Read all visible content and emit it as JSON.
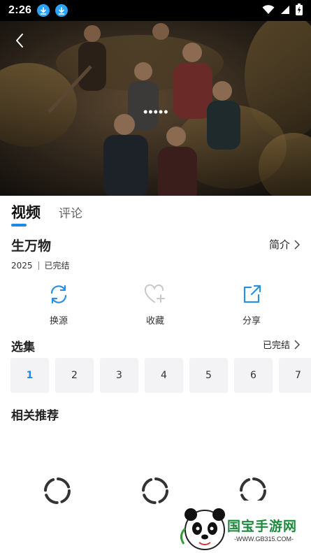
{
  "status_bar": {
    "time": "2:26"
  },
  "player": {
    "loading_indicator": "•••••"
  },
  "tabs": [
    {
      "label": "视频",
      "active": true
    },
    {
      "label": "评论",
      "active": false
    }
  ],
  "show": {
    "title": "生万物",
    "year": "2025",
    "status": "已完结"
  },
  "intro_link": "简介",
  "actions": [
    {
      "label": "换源",
      "icon": "refresh-icon"
    },
    {
      "label": "收藏",
      "icon": "heart-plus-icon"
    },
    {
      "label": "分享",
      "icon": "share-icon"
    }
  ],
  "episodes": {
    "header": "选集",
    "status": "已完结",
    "items": [
      "1",
      "2",
      "3",
      "4",
      "5",
      "6",
      "7"
    ],
    "selected": "1"
  },
  "recommendations": {
    "header": "相关推荐"
  },
  "watermark": {
    "brand": "国宝手游网",
    "url": "-WWW.GB315.COM-"
  },
  "colors": {
    "accent": "#1e88e5",
    "status_bar": "#000000",
    "episode_bg": "#f3f3f5"
  }
}
